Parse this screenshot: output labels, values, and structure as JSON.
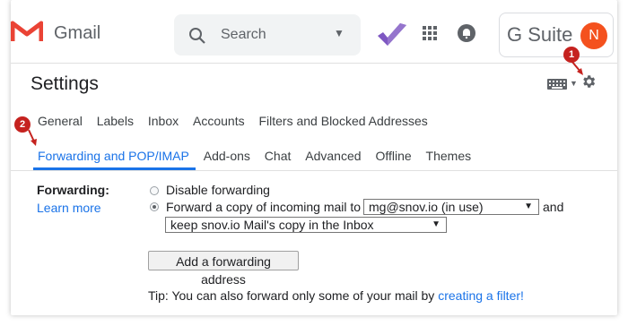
{
  "brand": {
    "app_name": "Gmail",
    "suite_name": "G Suite",
    "avatar_initial": "N",
    "colors": {
      "accent": "#1a73e8",
      "badge": "#c5221f",
      "avatar": "#f4511e",
      "gmail_red": "#ea4335"
    }
  },
  "search": {
    "placeholder": "Search"
  },
  "header": {
    "title": "Settings"
  },
  "annotations": {
    "badge_1": "1",
    "badge_2": "2"
  },
  "tabs": {
    "row1": [
      {
        "label": "General"
      },
      {
        "label": "Labels"
      },
      {
        "label": "Inbox"
      },
      {
        "label": "Accounts"
      },
      {
        "label": "Filters and Blocked Addresses"
      }
    ],
    "row2": [
      {
        "label": "Forwarding and POP/IMAP",
        "active": true
      },
      {
        "label": "Add-ons"
      },
      {
        "label": "Chat"
      },
      {
        "label": "Advanced"
      },
      {
        "label": "Offline"
      },
      {
        "label": "Themes"
      }
    ]
  },
  "forwarding": {
    "label": "Forwarding:",
    "learn_more": "Learn more",
    "option_disable": "Disable forwarding",
    "option_forward": "Forward a copy of incoming mail to",
    "email_value": "mg@snov.io (in use)",
    "and_text": "and",
    "keep_value": "keep snov.io Mail's copy in the Inbox",
    "add_button": "Add a forwarding address",
    "tip_text": "Tip: You can also forward only some of your mail by ",
    "tip_link": "creating a filter!"
  },
  "icons": [
    "gmail-logo-icon",
    "search-icon",
    "chevron-down-icon",
    "tasks-icon",
    "apps-grid-icon",
    "notifications-icon",
    "keyboard-icon",
    "gear-icon"
  ]
}
